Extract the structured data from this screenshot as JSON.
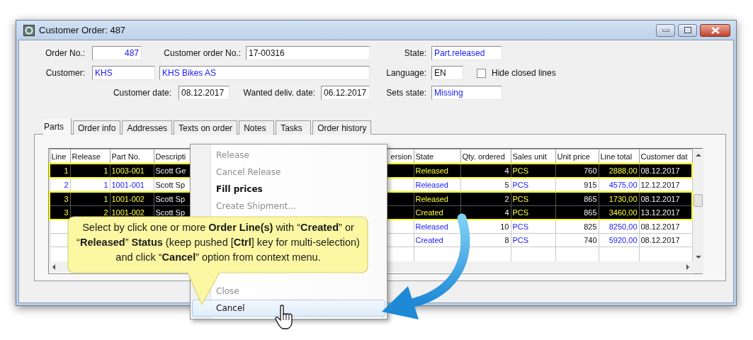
{
  "window": {
    "title": "Customer Order: 487"
  },
  "form": {
    "rows": [
      [
        {
          "kind": "field",
          "label": "Order No.:",
          "value": "487",
          "linked": true
        },
        {
          "kind": "field",
          "label": "Customer order No.:",
          "value": "17-00316",
          "linked": false
        },
        {
          "kind": "field",
          "label": "State:",
          "value": "Part.released",
          "linked": true
        }
      ],
      [
        {
          "kind": "field",
          "label": "Customer:",
          "value": "KHS",
          "linked": true
        },
        {
          "kind": "field",
          "value": "KHS Bikes AS",
          "linked": true
        },
        {
          "kind": "field",
          "label": "Language:",
          "value": "EN",
          "linked": false
        },
        {
          "kind": "checkbox",
          "label": "Hide closed lines",
          "checked": false
        }
      ],
      [
        {
          "kind": "field",
          "label": "Customer date:",
          "value": "08.12.2017",
          "linked": false
        },
        {
          "kind": "field",
          "label": "Wanted deliv. date:",
          "value": "06.12.2017",
          "linked": false
        },
        {
          "kind": "field",
          "label": "Sets state:",
          "value": "Missing",
          "linked": true
        }
      ]
    ]
  },
  "tabs": [
    {
      "label": "Parts",
      "selected": true
    },
    {
      "label": "Order info",
      "selected": false
    },
    {
      "label": "Addresses",
      "selected": false
    },
    {
      "label": "Texts on order",
      "selected": false
    },
    {
      "label": "Notes",
      "selected": false
    },
    {
      "label": "Tasks",
      "selected": false
    },
    {
      "label": "Order history",
      "selected": false
    }
  ],
  "table": {
    "columns": [
      {
        "label": "Line",
        "linked": true
      },
      {
        "label": "Release",
        "linked": true
      },
      {
        "label": "Part No.",
        "linked": true
      },
      {
        "label": "Descripti",
        "linked": false
      },
      {
        "label": "ersion"
      },
      {
        "label": "State",
        "linked": true
      },
      {
        "label": "Qty. ordered",
        "linked": false
      },
      {
        "label": "Sales unit",
        "linked": true
      },
      {
        "label": "Unit price",
        "linked": false
      },
      {
        "label": "Line total",
        "linked": true
      },
      {
        "label": "Customer dat",
        "linked": false
      }
    ],
    "rows": [
      {
        "selected": true,
        "cells": [
          "1",
          "1",
          "1003-001",
          "Scott Ge",
          null,
          "Released",
          "4",
          "PCS",
          "760",
          "2888,00",
          "08.12.2017"
        ]
      },
      {
        "selected": false,
        "cells": [
          "2",
          "1",
          "1001-001",
          "Scott Sp",
          null,
          "Released",
          "5",
          "PCS",
          "915",
          "4575,00",
          "12.12.2017"
        ]
      },
      {
        "selected": true,
        "cells": [
          "3",
          "1",
          "1001-002",
          "Scott Sp",
          null,
          "Released",
          "2",
          "PCS",
          "865",
          "1730,00",
          "08.12.2017"
        ]
      },
      {
        "selected": true,
        "cells": [
          "3",
          "2",
          "1001-002",
          "Scott Sp",
          null,
          "Created",
          "4",
          "PCS",
          "865",
          "3460,00",
          "13.12.2017"
        ]
      },
      {
        "selected": false,
        "cells": [
          null,
          null,
          null,
          null,
          null,
          "Released",
          "10",
          "PCS",
          "825",
          "8250,00",
          "08.12.2017"
        ]
      },
      {
        "selected": false,
        "cells": [
          null,
          null,
          null,
          null,
          null,
          "Created",
          "8",
          "PCS",
          "740",
          "5920,00",
          "08.12.2017"
        ]
      }
    ]
  },
  "context_menu": {
    "items": [
      {
        "kind": "item",
        "label": "Release",
        "disabled": true,
        "default": false,
        "highlighted": false
      },
      {
        "kind": "item",
        "label": "Cancel Release",
        "disabled": true,
        "default": false,
        "highlighted": false
      },
      {
        "kind": "item",
        "label": "Fill prices",
        "disabled": false,
        "default": true,
        "highlighted": false
      },
      {
        "kind": "item",
        "label": "Create Shipment...",
        "disabled": true,
        "default": false,
        "highlighted": false
      },
      {
        "kind": "covered"
      },
      {
        "kind": "covered"
      },
      {
        "kind": "covered"
      },
      {
        "kind": "covered"
      },
      {
        "kind": "item",
        "label": "Close",
        "disabled": true,
        "default": false,
        "highlighted": false
      },
      {
        "kind": "item",
        "label": "Cancel",
        "disabled": false,
        "default": false,
        "highlighted": true
      }
    ]
  },
  "callout": {
    "text": "Select by click one or more **Order Line(s)** with “**Created**” or “**Released**” **Status** (keep pushed [**Ctrl**] key for multi-selection) and click “**Cancel**” option from context menu."
  }
}
